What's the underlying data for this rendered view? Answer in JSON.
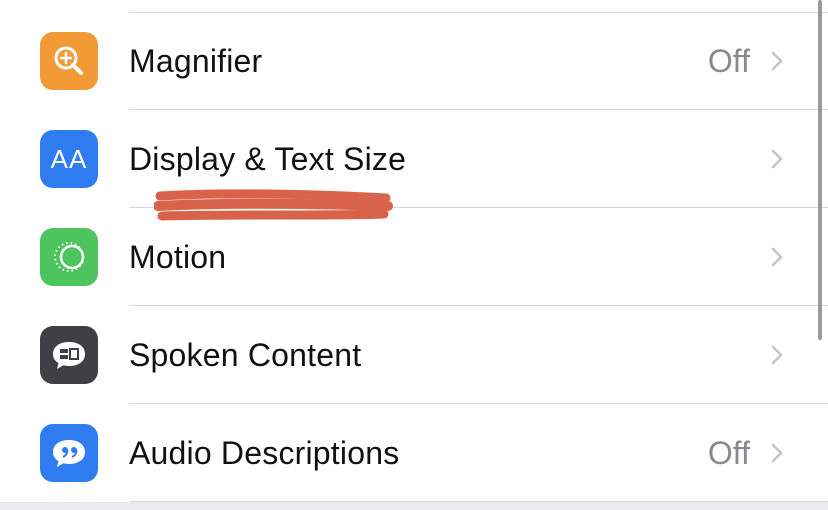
{
  "rows": [
    {
      "label": "Magnifier",
      "value": "Off",
      "icon": "magnifier-icon",
      "icon_color": "#f19a36"
    },
    {
      "label": "Display & Text Size",
      "value": "",
      "icon": "text-size-icon",
      "icon_color": "#2f7bf0"
    },
    {
      "label": "Motion",
      "value": "",
      "icon": "motion-icon",
      "icon_color": "#4ec45e"
    },
    {
      "label": "Spoken Content",
      "value": "",
      "icon": "spoken-content-icon",
      "icon_color": "#3f3f44"
    },
    {
      "label": "Audio Descriptions",
      "value": "Off",
      "icon": "audio-descriptions-icon",
      "icon_color": "#2f7bf0"
    }
  ],
  "icon_text": {
    "text_size": "AA"
  },
  "colors": {
    "highlight_stroke": "#d9634a",
    "chevron": "#c4c4c9"
  }
}
